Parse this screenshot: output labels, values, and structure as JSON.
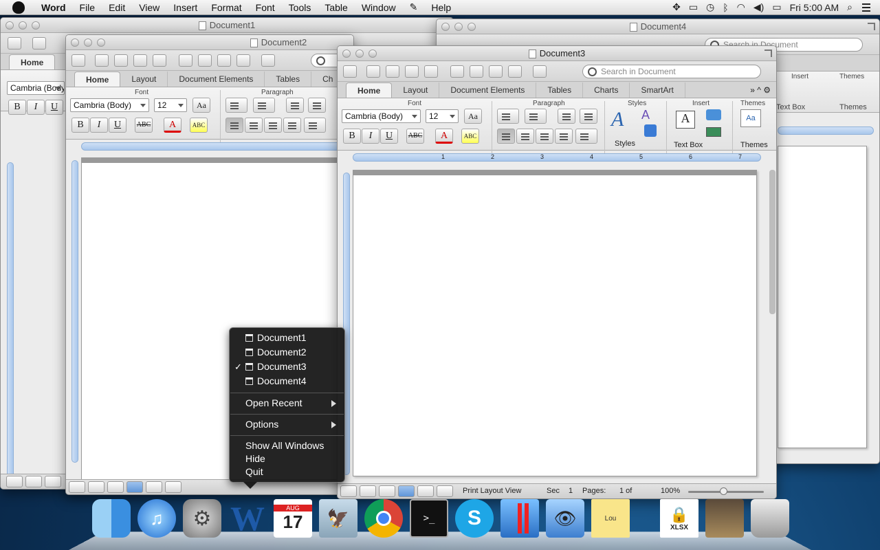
{
  "menubar": {
    "app": "Word",
    "items": [
      "File",
      "Edit",
      "View",
      "Insert",
      "Format",
      "Font",
      "Tools",
      "Table",
      "Window",
      "Help"
    ],
    "clock": "Fri 5:00 AM"
  },
  "windows": {
    "doc1": {
      "title": "Document1",
      "tab_home": "Home",
      "font": "Cambria (Body)"
    },
    "doc2": {
      "title": "Document2",
      "tabs": [
        "Home",
        "Layout",
        "Document Elements",
        "Tables",
        "Ch"
      ],
      "font_label": "Font",
      "paragraph_label": "Paragraph",
      "font": "Cambria (Body)",
      "size": "12"
    },
    "doc4": {
      "title": "Document4",
      "search_placeholder": "Search in Document",
      "insert_label": "Insert",
      "themes_label": "Themes",
      "textbox": "Text Box",
      "themes": "Themes"
    },
    "doc3": {
      "title": "Document3",
      "search_placeholder": "Search in Document",
      "tabs": [
        "Home",
        "Layout",
        "Document Elements",
        "Tables",
        "Charts",
        "SmartArt"
      ],
      "groups": {
        "font": "Font",
        "paragraph": "Paragraph",
        "styles": "Styles",
        "insert": "Insert",
        "themes": "Themes"
      },
      "font": "Cambria (Body)",
      "size": "12",
      "styles_btn": "Styles",
      "textbox_btn": "Text Box",
      "themes_btn": "Themes",
      "status": {
        "view": "Print Layout View",
        "sec_label": "Sec",
        "sec": "1",
        "pages_label": "Pages:",
        "pages": "1 of",
        "zoom": "100%"
      },
      "ruler": [
        "1",
        "2",
        "3",
        "4",
        "5",
        "6",
        "7"
      ]
    }
  },
  "dockmenu": {
    "windows": [
      {
        "label": "Document1",
        "checked": false
      },
      {
        "label": "Document2",
        "checked": false
      },
      {
        "label": "Document3",
        "checked": true
      },
      {
        "label": "Document4",
        "checked": false
      }
    ],
    "open_recent": "Open Recent",
    "options": "Options",
    "show_all": "Show All Windows",
    "hide": "Hide",
    "quit": "Quit",
    "check": "✓"
  },
  "dock": {
    "calendar_month": "AUG",
    "calendar_day": "17",
    "xlsx": "XLSX",
    "stickies": "Lou"
  }
}
